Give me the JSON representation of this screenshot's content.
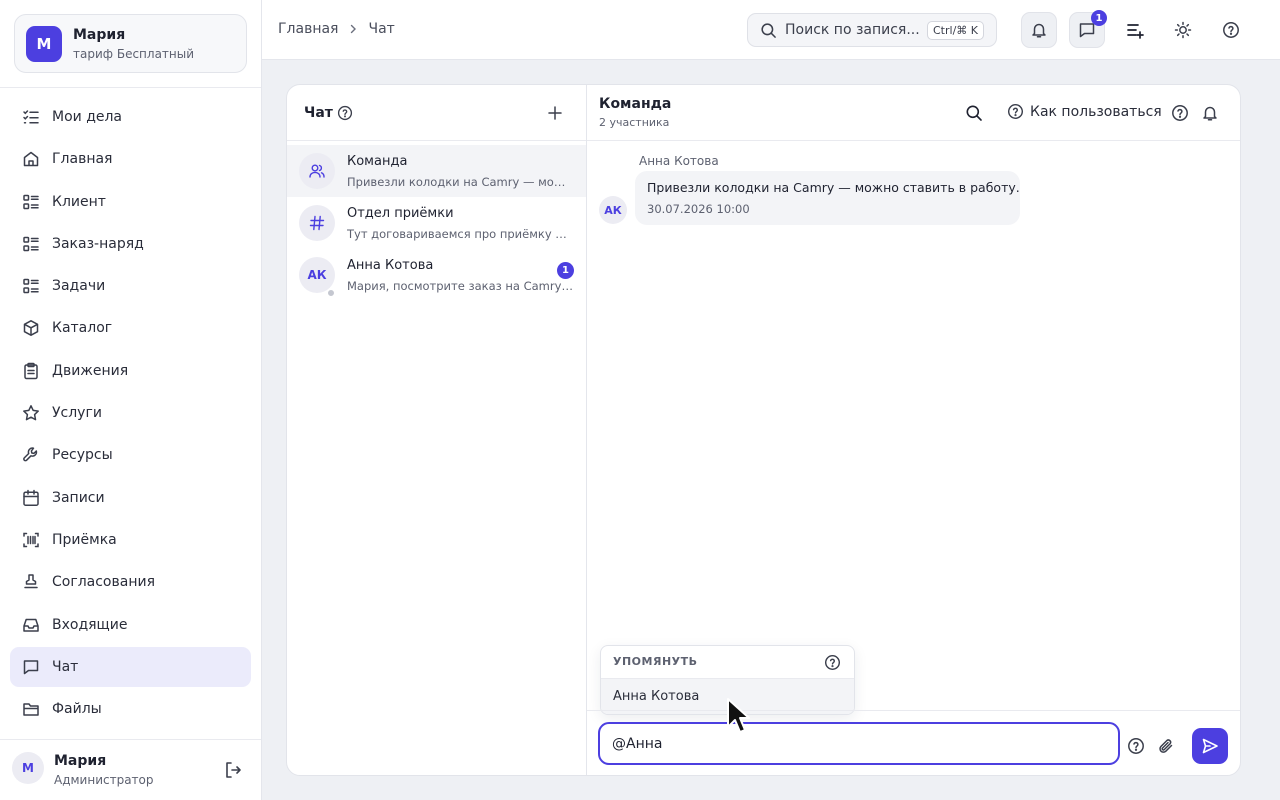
{
  "brand": {
    "avatar_letter": "М",
    "name": "Мария",
    "plan": "тариф Бесплатный",
    "accent_color": "#4c3fe0"
  },
  "sidebar": {
    "items": [
      {
        "label": "Мои дела",
        "icon": "list-check-icon"
      },
      {
        "label": "Главная",
        "icon": "home-icon"
      },
      {
        "label": "Клиент",
        "icon": "list-icon"
      },
      {
        "label": "Заказ-наряд",
        "icon": "list-icon"
      },
      {
        "label": "Задачи",
        "icon": "list-icon"
      },
      {
        "label": "Каталог",
        "icon": "box-icon"
      },
      {
        "label": "Движения",
        "icon": "clipboard-icon"
      },
      {
        "label": "Услуги",
        "icon": "star-icon"
      },
      {
        "label": "Ресурсы",
        "icon": "wrench-icon"
      },
      {
        "label": "Записи",
        "icon": "calendar-icon"
      },
      {
        "label": "Приёмка",
        "icon": "barcode-icon"
      },
      {
        "label": "Согласования",
        "icon": "stamp-icon"
      },
      {
        "label": "Входящие",
        "icon": "inbox-icon"
      },
      {
        "label": "Чат",
        "icon": "chat-icon",
        "active": true
      },
      {
        "label": "Файлы",
        "icon": "folder-icon"
      }
    ],
    "user": {
      "avatar_letter": "М",
      "name": "Мария",
      "role": "Администратор"
    }
  },
  "topbar": {
    "breadcrumb": [
      "Главная",
      "Чат"
    ],
    "search": {
      "placeholder": "Поиск по запися...",
      "shortcut": "Ctrl/⌘ K"
    },
    "messages_badge": "1"
  },
  "chatlist": {
    "title": "Чат",
    "conversations": [
      {
        "title": "Команда",
        "preview": "Привезли колодки на Camry — можно ставить в работу.",
        "avatar": "team-icon",
        "active": true
      },
      {
        "title": "Отдел приёмки",
        "preview": "Тут договариваемся про приёмку машин.",
        "avatar": "hash-icon"
      },
      {
        "title": "Анна Котова",
        "preview": "Мария, посмотрите заказ на Camry, пожалуйста.",
        "avatar_text": "АК",
        "badge": "1"
      }
    ]
  },
  "chat": {
    "title": "Команда",
    "subtitle": "2 участника",
    "howto_label": "Как пользоваться",
    "messages": [
      {
        "author": "Анна Котова",
        "avatar_text": "АК",
        "text": "Привезли колодки на Camry — можно ставить в работу.",
        "time": "30.07.2026 10:00"
      }
    ],
    "mention": {
      "title": "УПОМЯНУТЬ",
      "options": [
        "Анна Котова"
      ]
    },
    "composer": {
      "value": "@Анна"
    }
  }
}
